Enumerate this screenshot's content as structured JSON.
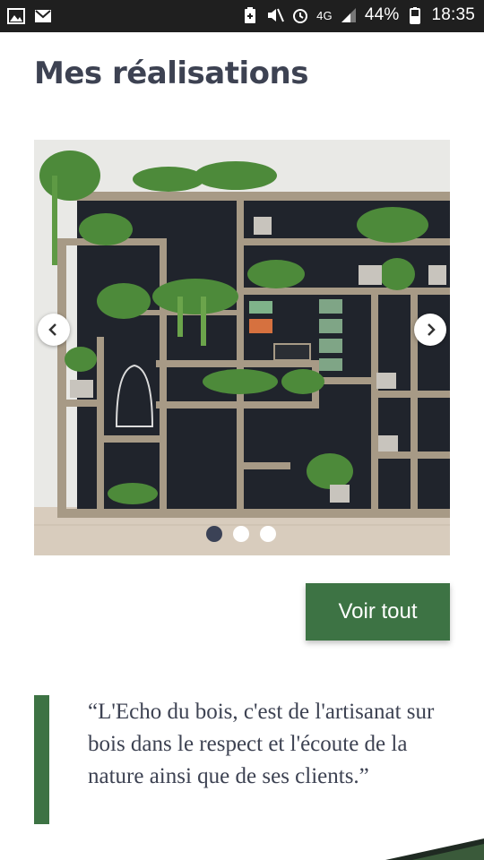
{
  "status_bar": {
    "battery": "44%",
    "time": "18:35",
    "network": "4G",
    "icons": [
      "image-icon",
      "mail-icon",
      "battery-saver-icon",
      "mute-icon",
      "alarm-icon",
      "signal-icon",
      "battery-icon"
    ]
  },
  "page": {
    "title": "Mes réalisations"
  },
  "carousel": {
    "image_alt": "Wooden shelving with plants",
    "slides": 3,
    "active_index": 0
  },
  "actions": {
    "voir_tout": "Voir tout"
  },
  "quote": {
    "text": "“L'Echo du bois, c'est de l'artisanat sur bois dans le respect et l'écoute de la nature ainsi que de ses clients.”"
  },
  "colors": {
    "accent": "#3d7344",
    "title": "#3d4252",
    "statusbar": "#1f1f1f"
  }
}
